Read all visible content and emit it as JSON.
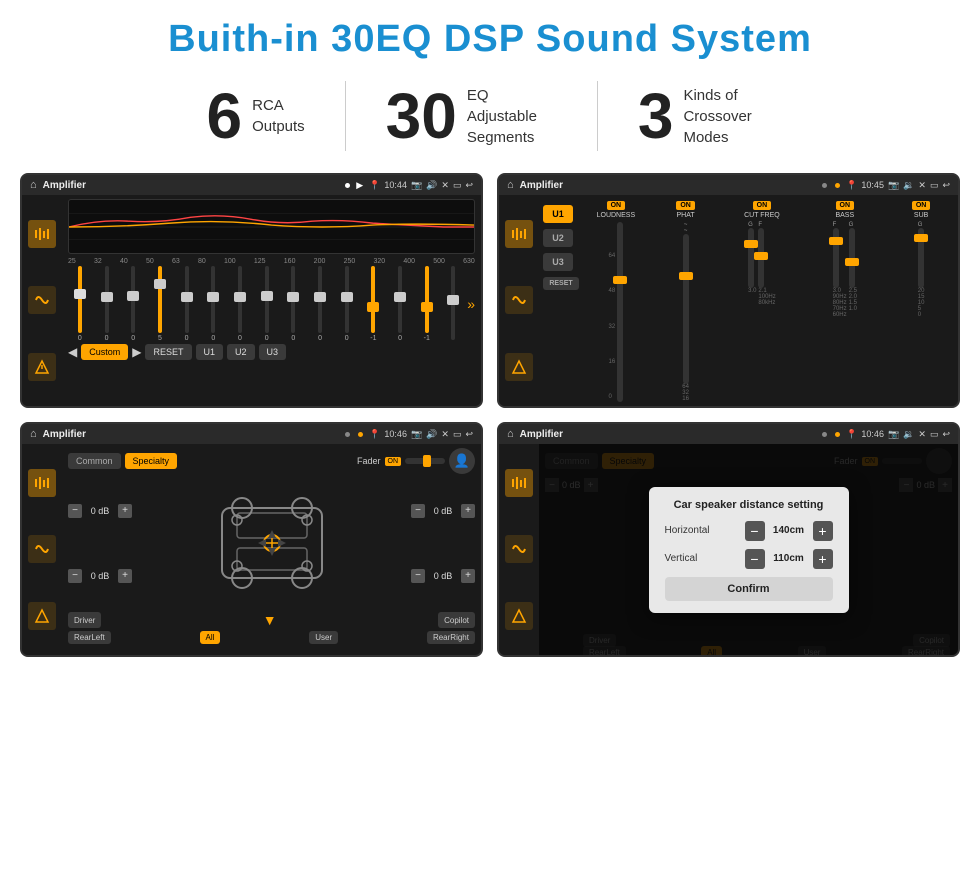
{
  "page": {
    "title": "Buith-in 30EQ DSP Sound System",
    "background": "#ffffff"
  },
  "stats": [
    {
      "number": "6",
      "label_line1": "RCA",
      "label_line2": "Outputs"
    },
    {
      "number": "30",
      "label_line1": "EQ Adjustable",
      "label_line2": "Segments"
    },
    {
      "number": "3",
      "label_line1": "Kinds of",
      "label_line2": "Crossover Modes"
    }
  ],
  "screens": [
    {
      "id": "screen1",
      "title": "Amplifier",
      "time": "10:44",
      "type": "eq",
      "eq_frequencies": [
        "25",
        "32",
        "40",
        "50",
        "63",
        "80",
        "100",
        "125",
        "160",
        "200",
        "250",
        "320",
        "400",
        "500",
        "630"
      ],
      "eq_values": [
        "0",
        "0",
        "0",
        "5",
        "0",
        "0",
        "0",
        "0",
        "0",
        "0",
        "0",
        "-1",
        "0",
        "-1",
        ""
      ],
      "eq_buttons": [
        "Custom",
        "RESET",
        "U1",
        "U2",
        "U3"
      ],
      "eq_active_button": "Custom"
    },
    {
      "id": "screen2",
      "title": "Amplifier",
      "time": "10:45",
      "type": "amplifier",
      "u_buttons": [
        "U1",
        "U2",
        "U3"
      ],
      "active_u": "U1",
      "controls": [
        "LOUDNESS",
        "PHAT",
        "CUT FREQ",
        "BASS",
        "SUB"
      ],
      "control_scales": [
        [
          "64",
          "48",
          "32",
          "16",
          "0"
        ],
        [
          "64",
          "32",
          "16"
        ],
        [
          "G 3.0",
          "2.1",
          "100Hz",
          "80kHz"
        ],
        [
          "F G 3.0",
          "90Hz",
          "80Hz",
          "70Hz",
          "60Hz"
        ],
        [
          "G 20",
          "15",
          "10",
          "5",
          "0"
        ]
      ]
    },
    {
      "id": "screen3",
      "title": "Amplifier",
      "time": "10:46",
      "type": "fader",
      "tabs": [
        "Common",
        "Specialty"
      ],
      "active_tab": "Specialty",
      "fader_label": "Fader",
      "fader_on": "ON",
      "db_values": [
        "0 dB",
        "0 dB",
        "0 dB",
        "0 dB"
      ],
      "bottom_buttons": [
        "Driver",
        "Copilot",
        "RearLeft",
        "All",
        "User",
        "RearRight"
      ]
    },
    {
      "id": "screen4",
      "title": "Amplifier",
      "time": "10:46",
      "type": "distance_dialog",
      "tabs": [
        "Common",
        "Specialty"
      ],
      "active_tab": "Specialty",
      "dialog": {
        "title": "Car speaker distance setting",
        "horizontal_label": "Horizontal",
        "horizontal_value": "140cm",
        "vertical_label": "Vertical",
        "vertical_value": "110cm",
        "confirm_label": "Confirm"
      },
      "bottom_buttons": [
        "Driver",
        "Copilot",
        "RearLeft",
        "All",
        "User",
        "RearRight"
      ]
    }
  ]
}
